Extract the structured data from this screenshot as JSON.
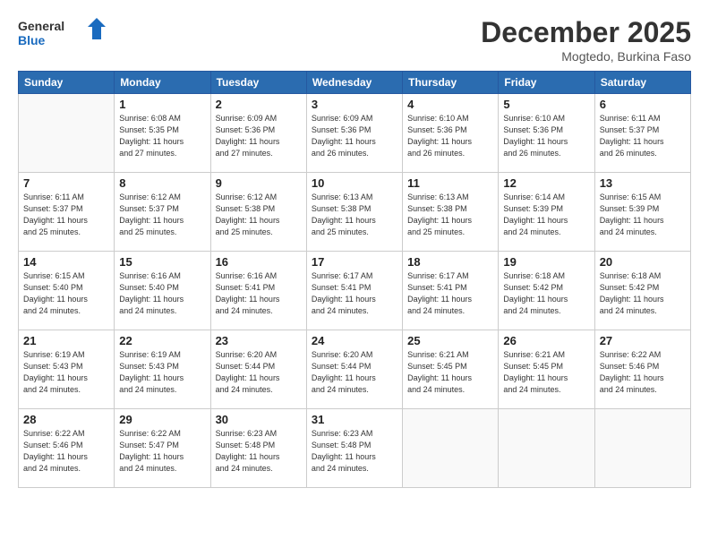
{
  "logo": {
    "general": "General",
    "blue": "Blue"
  },
  "header": {
    "month": "December 2025",
    "location": "Mogtedo, Burkina Faso"
  },
  "weekdays": [
    "Sunday",
    "Monday",
    "Tuesday",
    "Wednesday",
    "Thursday",
    "Friday",
    "Saturday"
  ],
  "weeks": [
    [
      {
        "day": "",
        "info": ""
      },
      {
        "day": "1",
        "info": "Sunrise: 6:08 AM\nSunset: 5:35 PM\nDaylight: 11 hours\nand 27 minutes."
      },
      {
        "day": "2",
        "info": "Sunrise: 6:09 AM\nSunset: 5:36 PM\nDaylight: 11 hours\nand 27 minutes."
      },
      {
        "day": "3",
        "info": "Sunrise: 6:09 AM\nSunset: 5:36 PM\nDaylight: 11 hours\nand 26 minutes."
      },
      {
        "day": "4",
        "info": "Sunrise: 6:10 AM\nSunset: 5:36 PM\nDaylight: 11 hours\nand 26 minutes."
      },
      {
        "day": "5",
        "info": "Sunrise: 6:10 AM\nSunset: 5:36 PM\nDaylight: 11 hours\nand 26 minutes."
      },
      {
        "day": "6",
        "info": "Sunrise: 6:11 AM\nSunset: 5:37 PM\nDaylight: 11 hours\nand 26 minutes."
      }
    ],
    [
      {
        "day": "7",
        "info": "Sunrise: 6:11 AM\nSunset: 5:37 PM\nDaylight: 11 hours\nand 25 minutes."
      },
      {
        "day": "8",
        "info": "Sunrise: 6:12 AM\nSunset: 5:37 PM\nDaylight: 11 hours\nand 25 minutes."
      },
      {
        "day": "9",
        "info": "Sunrise: 6:12 AM\nSunset: 5:38 PM\nDaylight: 11 hours\nand 25 minutes."
      },
      {
        "day": "10",
        "info": "Sunrise: 6:13 AM\nSunset: 5:38 PM\nDaylight: 11 hours\nand 25 minutes."
      },
      {
        "day": "11",
        "info": "Sunrise: 6:13 AM\nSunset: 5:38 PM\nDaylight: 11 hours\nand 25 minutes."
      },
      {
        "day": "12",
        "info": "Sunrise: 6:14 AM\nSunset: 5:39 PM\nDaylight: 11 hours\nand 24 minutes."
      },
      {
        "day": "13",
        "info": "Sunrise: 6:15 AM\nSunset: 5:39 PM\nDaylight: 11 hours\nand 24 minutes."
      }
    ],
    [
      {
        "day": "14",
        "info": "Sunrise: 6:15 AM\nSunset: 5:40 PM\nDaylight: 11 hours\nand 24 minutes."
      },
      {
        "day": "15",
        "info": "Sunrise: 6:16 AM\nSunset: 5:40 PM\nDaylight: 11 hours\nand 24 minutes."
      },
      {
        "day": "16",
        "info": "Sunrise: 6:16 AM\nSunset: 5:41 PM\nDaylight: 11 hours\nand 24 minutes."
      },
      {
        "day": "17",
        "info": "Sunrise: 6:17 AM\nSunset: 5:41 PM\nDaylight: 11 hours\nand 24 minutes."
      },
      {
        "day": "18",
        "info": "Sunrise: 6:17 AM\nSunset: 5:41 PM\nDaylight: 11 hours\nand 24 minutes."
      },
      {
        "day": "19",
        "info": "Sunrise: 6:18 AM\nSunset: 5:42 PM\nDaylight: 11 hours\nand 24 minutes."
      },
      {
        "day": "20",
        "info": "Sunrise: 6:18 AM\nSunset: 5:42 PM\nDaylight: 11 hours\nand 24 minutes."
      }
    ],
    [
      {
        "day": "21",
        "info": "Sunrise: 6:19 AM\nSunset: 5:43 PM\nDaylight: 11 hours\nand 24 minutes."
      },
      {
        "day": "22",
        "info": "Sunrise: 6:19 AM\nSunset: 5:43 PM\nDaylight: 11 hours\nand 24 minutes."
      },
      {
        "day": "23",
        "info": "Sunrise: 6:20 AM\nSunset: 5:44 PM\nDaylight: 11 hours\nand 24 minutes."
      },
      {
        "day": "24",
        "info": "Sunrise: 6:20 AM\nSunset: 5:44 PM\nDaylight: 11 hours\nand 24 minutes."
      },
      {
        "day": "25",
        "info": "Sunrise: 6:21 AM\nSunset: 5:45 PM\nDaylight: 11 hours\nand 24 minutes."
      },
      {
        "day": "26",
        "info": "Sunrise: 6:21 AM\nSunset: 5:45 PM\nDaylight: 11 hours\nand 24 minutes."
      },
      {
        "day": "27",
        "info": "Sunrise: 6:22 AM\nSunset: 5:46 PM\nDaylight: 11 hours\nand 24 minutes."
      }
    ],
    [
      {
        "day": "28",
        "info": "Sunrise: 6:22 AM\nSunset: 5:46 PM\nDaylight: 11 hours\nand 24 minutes."
      },
      {
        "day": "29",
        "info": "Sunrise: 6:22 AM\nSunset: 5:47 PM\nDaylight: 11 hours\nand 24 minutes."
      },
      {
        "day": "30",
        "info": "Sunrise: 6:23 AM\nSunset: 5:48 PM\nDaylight: 11 hours\nand 24 minutes."
      },
      {
        "day": "31",
        "info": "Sunrise: 6:23 AM\nSunset: 5:48 PM\nDaylight: 11 hours\nand 24 minutes."
      },
      {
        "day": "",
        "info": ""
      },
      {
        "day": "",
        "info": ""
      },
      {
        "day": "",
        "info": ""
      }
    ]
  ]
}
